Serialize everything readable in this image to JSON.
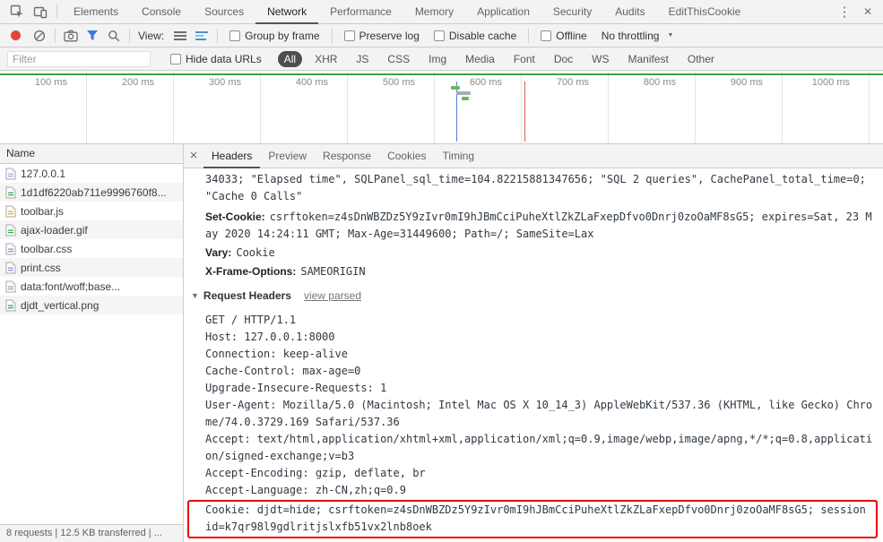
{
  "icons": {
    "kebab": "⋮",
    "close": "✕",
    "details_close": "×",
    "caret_down": "▼",
    "disclosure_down": "▼"
  },
  "colors": {
    "accent_blue": "#3b78e7",
    "record_red": "#e0443a",
    "highlight_red": "#ee0000",
    "overview_green": "#3aa33f",
    "selected_pill_bg": "#4d4d4d"
  },
  "tabbar": {
    "tabs": [
      "Elements",
      "Console",
      "Sources",
      "Network",
      "Performance",
      "Memory",
      "Application",
      "Security",
      "Audits",
      "EditThisCookie"
    ],
    "active_tab": "Network"
  },
  "toolbar": {
    "view_label": "View:",
    "group_by_frame": "Group by frame",
    "preserve_log": "Preserve log",
    "disable_cache": "Disable cache",
    "offline": "Offline",
    "throttling": "No throttling"
  },
  "filterbar": {
    "filter_placeholder": "Filter",
    "hide_data_urls": "Hide data URLs",
    "pills": [
      "All",
      "XHR",
      "JS",
      "CSS",
      "Img",
      "Media",
      "Font",
      "Doc",
      "WS",
      "Manifest",
      "Other"
    ],
    "active_pill": "All"
  },
  "overview": {
    "ticks": [
      "100 ms",
      "200 ms",
      "300 ms",
      "400 ms",
      "500 ms",
      "600 ms",
      "700 ms",
      "800 ms",
      "900 ms",
      "1000 ms"
    ]
  },
  "requests": {
    "column_header": "Name",
    "items": [
      {
        "name": "127.0.0.1",
        "type": "document"
      },
      {
        "name": "1d1df6220ab711e9996760f8...",
        "type": "image"
      },
      {
        "name": "toolbar.js",
        "type": "script"
      },
      {
        "name": "ajax-loader.gif",
        "type": "image"
      },
      {
        "name": "toolbar.css",
        "type": "stylesheet"
      },
      {
        "name": "print.css",
        "type": "stylesheet"
      },
      {
        "name": "data:font/woff;base...",
        "type": "font"
      },
      {
        "name": "djdt_vertical.png",
        "type": "image"
      }
    ]
  },
  "details": {
    "tabs": [
      "Headers",
      "Preview",
      "Response",
      "Cookies",
      "Timing"
    ],
    "active_tab": "Headers",
    "response_tail": "34033; \"Elapsed time\", SQLPanel_sql_time=104.82215881347656; \"SQL 2 queries\", CachePanel_total_time=0; \"Cache 0 Calls\"",
    "response_headers": [
      {
        "name": "Set-Cookie:",
        "value": "csrftoken=z4sDnWBZDz5Y9zIvr0mI9hJBmCciPuheXtlZkZLaFxepDfvo0Dnrj0zoOaMF8sG5; expires=Sat, 23 May 2020 14:24:11 GMT; Max-Age=31449600; Path=/; SameSite=Lax"
      },
      {
        "name": "Vary:",
        "value": "Cookie"
      },
      {
        "name": "X-Frame-Options:",
        "value": "SAMEORIGIN"
      }
    ],
    "request_headers_section": {
      "title": "Request Headers",
      "view_parsed": "view parsed"
    },
    "raw_request_headers": [
      "GET / HTTP/1.1",
      "Host: 127.0.0.1:8000",
      "Connection: keep-alive",
      "Cache-Control: max-age=0",
      "Upgrade-Insecure-Requests: 1",
      "User-Agent: Mozilla/5.0 (Macintosh; Intel Mac OS X 10_14_3) AppleWebKit/537.36 (KHTML, like Gecko) Chrome/74.0.3729.169 Safari/537.36",
      "Accept: text/html,application/xhtml+xml,application/xml;q=0.9,image/webp,image/apng,*/*;q=0.8,application/signed-exchange;v=b3",
      "Accept-Encoding: gzip, deflate, br",
      "Accept-Language: zh-CN,zh;q=0.9"
    ],
    "cookie_header": "Cookie: djdt=hide; csrftoken=z4sDnWBZDz5Y9zIvr0mI9hJBmCciPuheXtlZkZLaFxepDfvo0Dnrj0zoOaMF8sG5; sessionid=k7qr98l9gdlritjslxfb51vx2lnb8oek"
  },
  "statusbar": {
    "summary": "8 requests | 12.5 KB transferred | ..."
  }
}
